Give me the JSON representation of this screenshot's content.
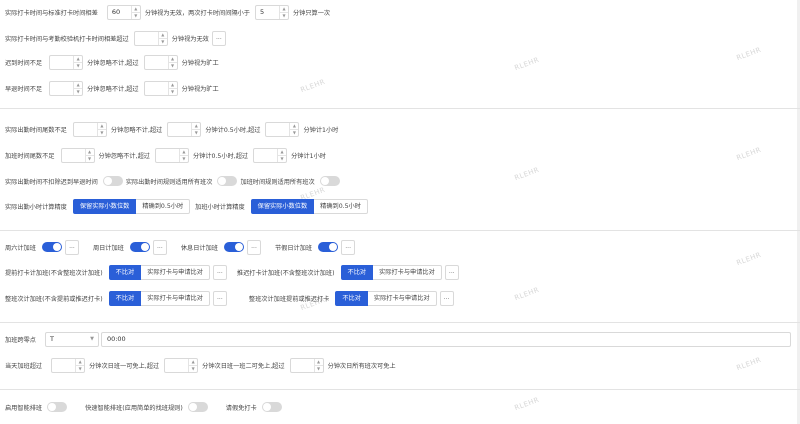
{
  "watermark": "RLEHR",
  "r1": {
    "a": "实际打卡时间与标准打卡时间相差",
    "v1": "60",
    "b": "分钟视为无效，两次打卡时间间隔小于",
    "v2": "5",
    "c": "分钟只算一次"
  },
  "r2": {
    "a": "实际打卡时间与考勤校验机打卡时间相差超过",
    "v1": "",
    "b": "分钟视为无效"
  },
  "r3": {
    "a": "迟到时间不足",
    "v1": "",
    "b": "分钟忽略不计,超过",
    "v2": "",
    "c": "分钟视为旷工"
  },
  "r4": {
    "a": "早退时间不足",
    "v1": "",
    "b": "分钟忽略不计,超过",
    "v2": "",
    "c": "分钟视为旷工"
  },
  "r5": {
    "a": "实际出勤时间尾数不足",
    "v1": "",
    "b": "分钟忽略不计,超过",
    "v2": "",
    "c": "分钟计0.5小时,超过",
    "v3": "",
    "d": "分钟计1小时"
  },
  "r6": {
    "a": "加班时间尾数不足",
    "v1": "",
    "b": "分钟忽略不计,超过",
    "v2": "",
    "c": "分钟计0.5小时,超过",
    "v3": "",
    "d": "分钟计1小时"
  },
  "r7": {
    "a": "实际出勤时间不扣除迟到早退时间",
    "b": "实际出勤时间规则适用所有班次",
    "c": "加班时间规则适用所有班次"
  },
  "r8": {
    "a": "实际出勤小时计算精度",
    "opt1": "保留实际小数位数",
    "opt2": "精确到0.5小时",
    "b": "加班小时计算精度",
    "opt3": "保留实际小数位数",
    "opt4": "精确到0.5小时"
  },
  "r9": {
    "a": "周六计加班",
    "b": "周日计加班",
    "c": "休息日计加班",
    "d": "节假日计加班"
  },
  "r10": {
    "a": "提前打卡计加班(不含整班次计加班)",
    "opt1": "不比对",
    "opt2": "实际打卡与申请比对",
    "b": "推迟打卡计加班(不含整班次计加班)",
    "opt3": "不比对",
    "opt4": "实际打卡与申请比对"
  },
  "r11": {
    "a": "整班次计加班(不含提前或推迟打卡)",
    "opt1": "不比对",
    "opt2": "实际打卡与申请比对",
    "b": "整班次计加班提前或推迟打卡",
    "opt3": "不比对",
    "opt4": "实际打卡与申请比对"
  },
  "r12": {
    "a": "加班跨零点",
    "sel": "T",
    "time": "00:00"
  },
  "r13": {
    "a": "当天加班超过",
    "v1": "",
    "b": "分钟次日班一可免上,超过",
    "v2": "",
    "c": "分钟次日班一班二可免上,超过",
    "v3": "",
    "d": "分钟次日所有班次可免上"
  },
  "r14": {
    "a": "启用智能排班",
    "b": "快速智能排班(应用简单的找班规则)",
    "c": "请假免打卡"
  },
  "dots": "...",
  "up": "▲",
  "down": "▼"
}
